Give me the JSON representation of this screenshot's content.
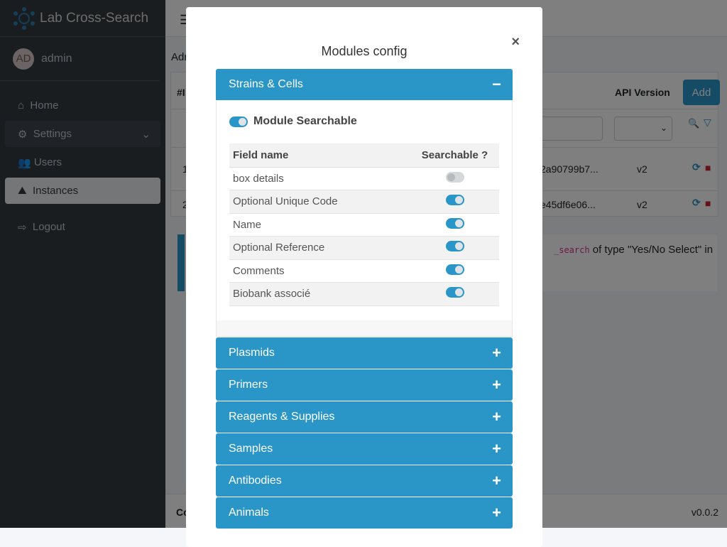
{
  "app": {
    "title": "Lab Cross-Search"
  },
  "user": {
    "initials": "AD",
    "name": "admin"
  },
  "sidebar": {
    "items": [
      {
        "label": "Home"
      },
      {
        "label": "Settings"
      },
      {
        "label": "Users"
      },
      {
        "label": "Instances"
      },
      {
        "label": "Logout"
      }
    ]
  },
  "background": {
    "breadcrumb": "Adm",
    "table": {
      "col_id": "#I",
      "col_api": "API Version",
      "add_label": "Add",
      "rows": [
        {
          "id": "1",
          "token": "2a90799b7...",
          "api": "v2"
        },
        {
          "id": "2",
          "token": "e45df6e06...",
          "api": "v2"
        }
      ]
    },
    "info": {
      "code": "_search",
      "text": " of type \"Yes/No Select\" in"
    },
    "footer": {
      "left": "Co",
      "version": "v0.0.2"
    }
  },
  "modal": {
    "title": "Modules config",
    "close": "×",
    "expanded": {
      "title": "Strains & Cells",
      "sign": "−",
      "module_searchable_label": "Module Searchable",
      "module_searchable": true,
      "columns": {
        "field": "Field name",
        "searchable": "Searchable ?"
      },
      "fields": [
        {
          "name": "box details",
          "searchable": false
        },
        {
          "name": "Optional Unique Code",
          "searchable": true
        },
        {
          "name": "Name",
          "searchable": true
        },
        {
          "name": "Optional Reference",
          "searchable": true
        },
        {
          "name": "Comments",
          "searchable": true
        },
        {
          "name": "Biobank associé",
          "searchable": true
        }
      ]
    },
    "collapsed": [
      {
        "title": "Plasmids",
        "sign": "+"
      },
      {
        "title": "Primers",
        "sign": "+"
      },
      {
        "title": "Reagents & Supplies",
        "sign": "+"
      },
      {
        "title": "Samples",
        "sign": "+"
      },
      {
        "title": "Antibodies",
        "sign": "+"
      },
      {
        "title": "Animals",
        "sign": "+"
      }
    ]
  },
  "colors": {
    "accent": "#2a96c8",
    "sidebar": "#343a40",
    "danger": "#c82333"
  }
}
